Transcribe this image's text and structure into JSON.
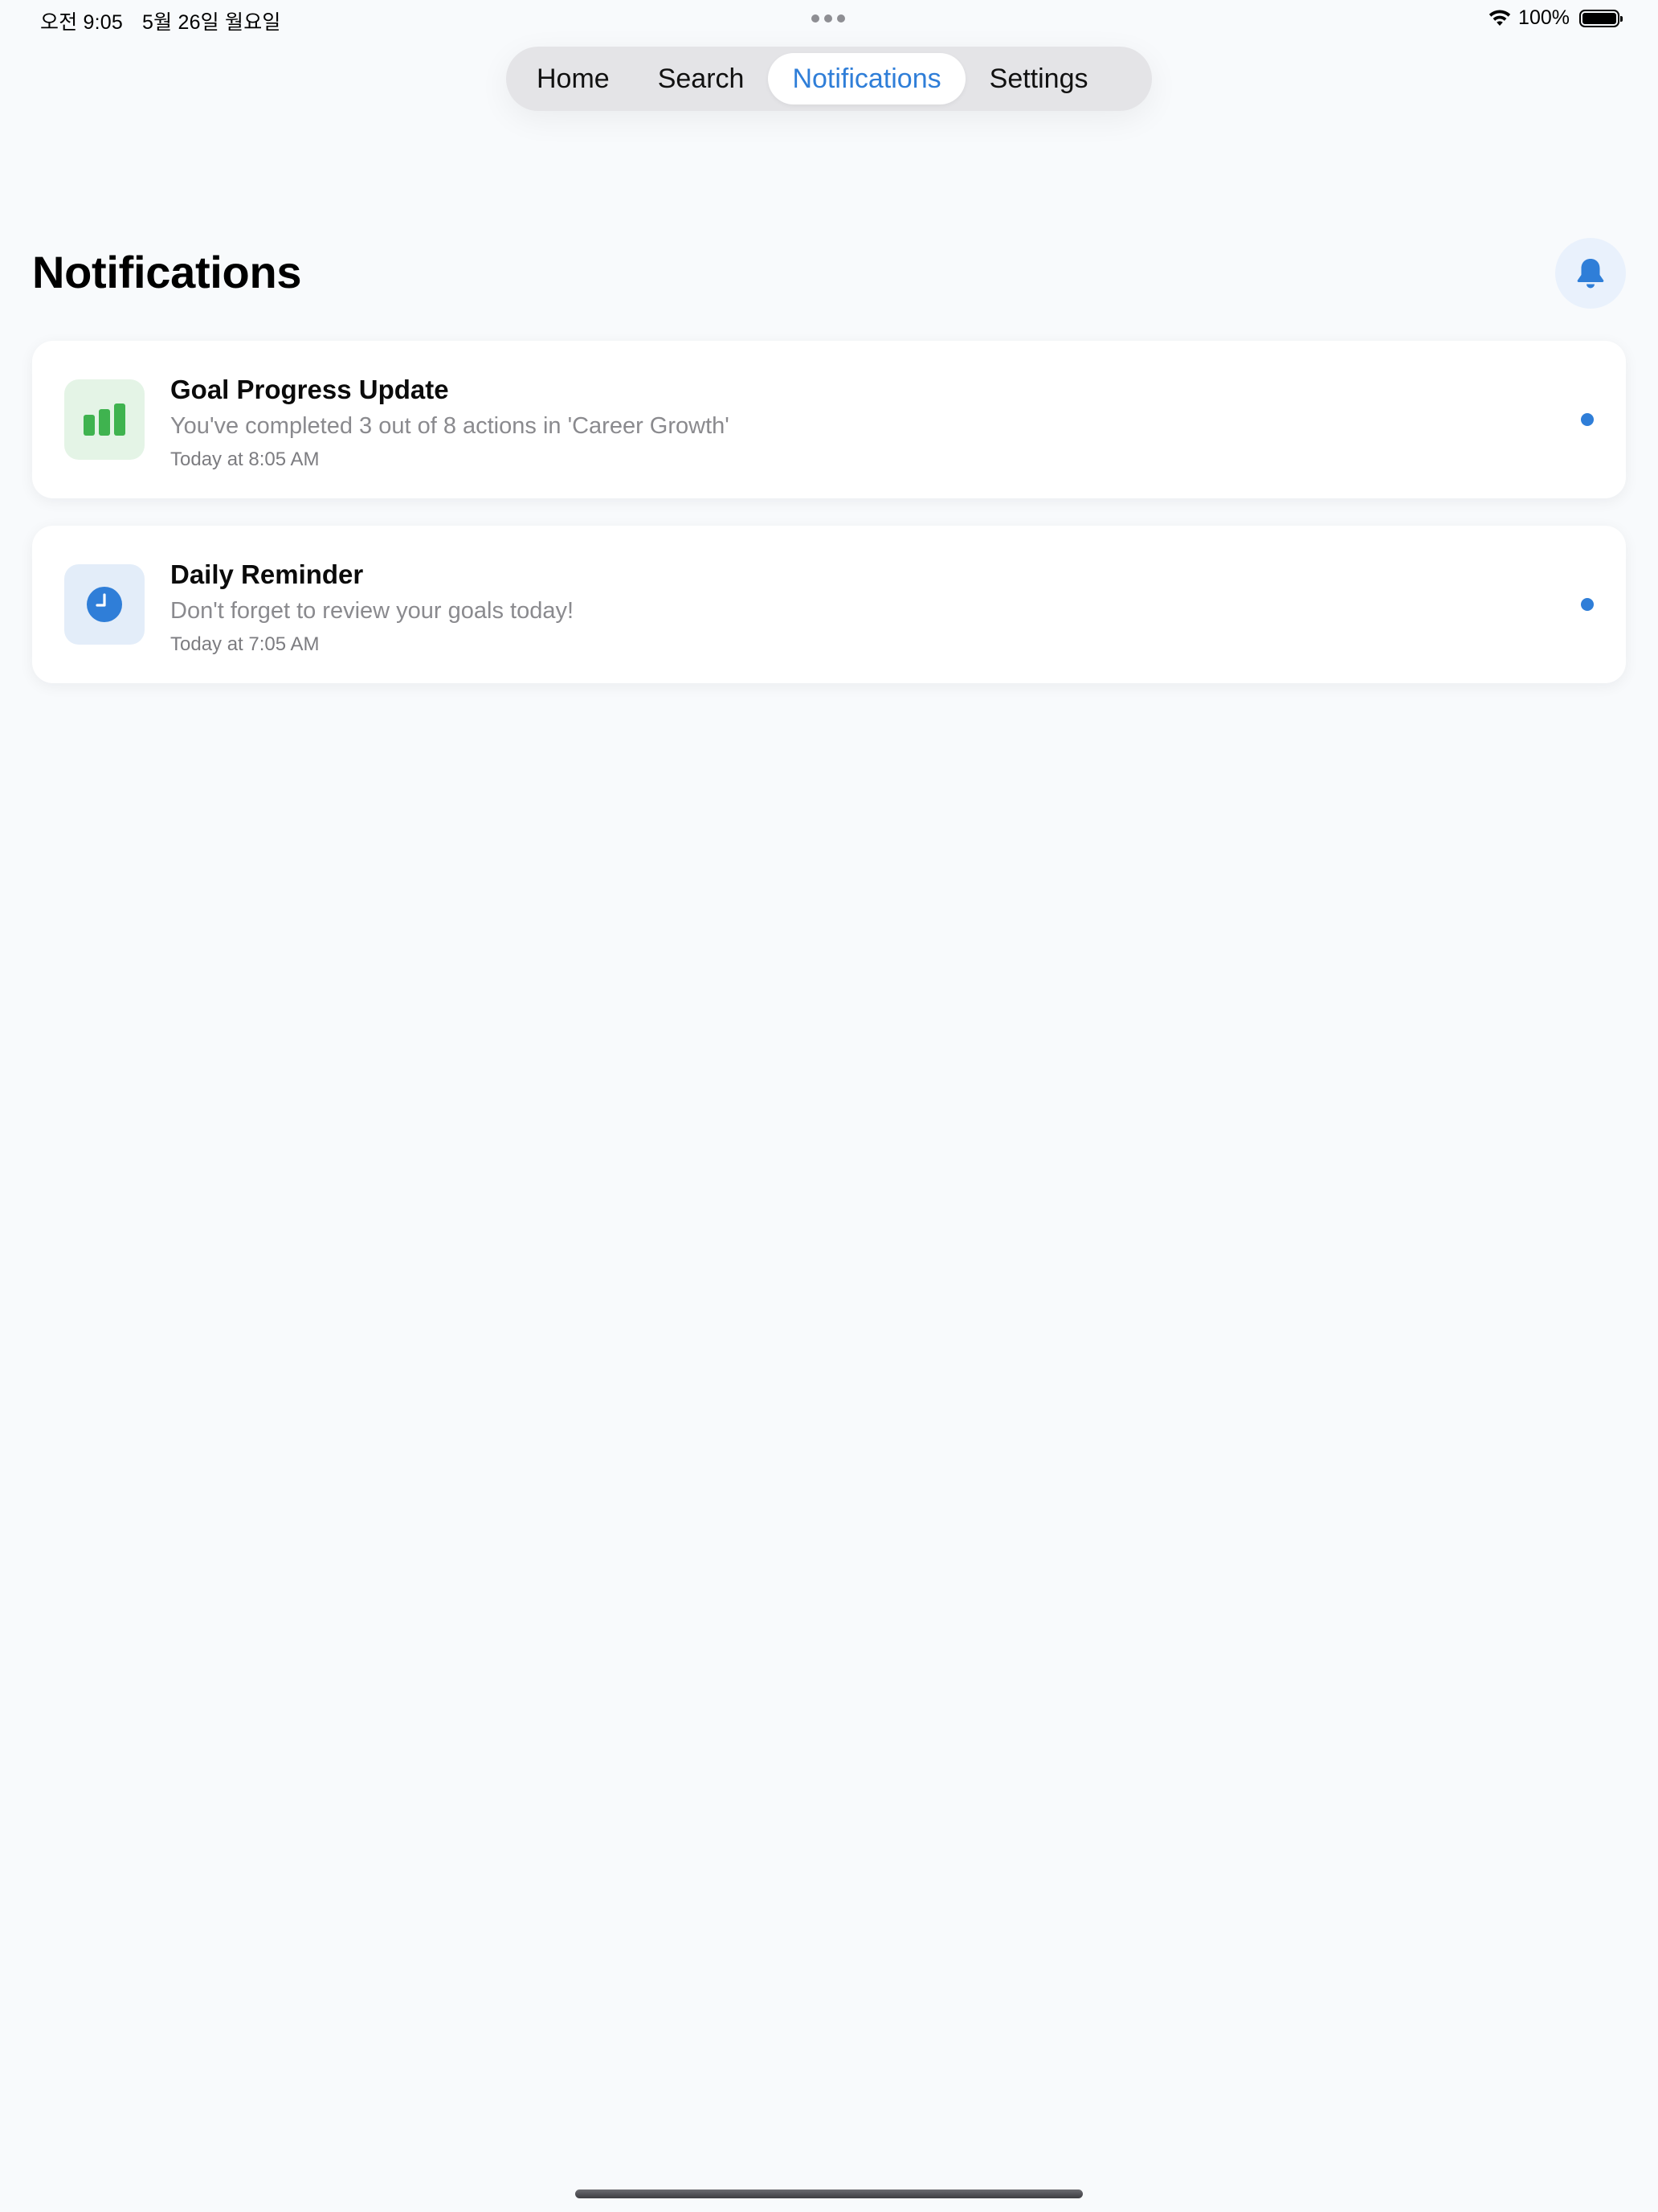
{
  "status_bar": {
    "time": "오전 9:05",
    "date": "5월 26일 월요일",
    "battery": "100%"
  },
  "tabs": [
    {
      "label": "Home",
      "active": false
    },
    {
      "label": "Search",
      "active": false
    },
    {
      "label": "Notifications",
      "active": true
    },
    {
      "label": "Settings",
      "active": false
    }
  ],
  "header": {
    "title": "Notifications",
    "action_icon": "bell-icon"
  },
  "notifications": [
    {
      "icon": "bar-chart-icon",
      "icon_color": "#3fb34f",
      "icon_bg": "#e4f4e6",
      "title": "Goal Progress Update",
      "message": "You've completed 3 out of 8 actions in 'Career Growth'",
      "time": "Today at 8:05 AM",
      "unread": true
    },
    {
      "icon": "clock-icon",
      "icon_color": "#2f7ed8",
      "icon_bg": "#e3edf9",
      "title": "Daily Reminder",
      "message": "Don't forget to review your goals today!",
      "time": "Today at 7:05 AM",
      "unread": true
    }
  ],
  "colors": {
    "accent": "#2f7ed8",
    "background": "#f8fafc",
    "card": "#ffffff"
  }
}
